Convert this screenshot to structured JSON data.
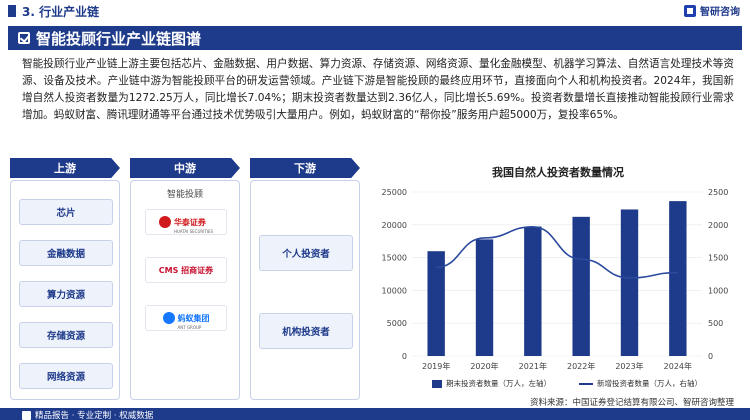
{
  "header": {
    "section_title": "3. 行业产业链",
    "brand_name": "智研咨询"
  },
  "banner": {
    "title": "智能投顾行业产业链图谱"
  },
  "intro": {
    "text": "智能投顾行业产业链上游主要包括芯片、金融数据、用户数据、算力资源、存储资源、网络资源、量化金融模型、机器学习算法、自然语言处理技术等资源、设备及技术。产业链中游为智能投顾平台的研发运营领域。产业链下游是智能投顾的最终应用环节，直接面向个人和机构投资者。2024年，我国新增自然人投资者数量为1272.25万人，同比增长7.04%；期末投资者数量达到2.36亿人，同比增长5.69%。投资者数量增长直接推动智能投顾行业需求增加。蚂蚁财富、腾讯理财通等平台通过技术优势吸引大量用户。例如，蚂蚁财富的“帮你投”服务用户超5000万，复投率65%。"
  },
  "chain": {
    "upstream": {
      "title": "上游",
      "items": [
        "芯片",
        "金融数据",
        "算力资源",
        "存储资源",
        "网络资源"
      ]
    },
    "midstream": {
      "title": "中游",
      "label": "智能投顾",
      "logos": [
        {
          "icon": "huatai-securities-logo",
          "text": "华泰证券",
          "sub": "HUATAI SECURITIES",
          "color": "#d0191c"
        },
        {
          "icon": "cms-securities-logo",
          "text": "CMS 招商证券",
          "sub": "",
          "color": "#c8102e"
        },
        {
          "icon": "ant-group-logo",
          "text": "蚂蚁集团",
          "sub": "ANT GROUP",
          "color": "#1677ff"
        }
      ]
    },
    "downstream": {
      "title": "下游",
      "items": [
        "个人投资者",
        "机构投资者"
      ]
    }
  },
  "chart_data": {
    "type": "bar",
    "title": "我国自然人投资者数量情况",
    "categories": [
      "2019年",
      "2020年",
      "2021年",
      "2022年",
      "2023年",
      "2024年"
    ],
    "series": [
      {
        "name": "期末投资者数量（万人，左轴）",
        "type": "bar",
        "axis": "left",
        "values": [
          15975,
          17777,
          19740,
          21214,
          22338,
          23610
        ]
      },
      {
        "name": "新增投资者数量（万人，右轴）",
        "type": "line",
        "axis": "right",
        "values": [
          1350,
          1800,
          1970,
          1475,
          1190,
          1272.25
        ]
      }
    ],
    "left_axis": {
      "min": 0,
      "max": 25000,
      "ticks": [
        "0",
        "5000",
        "10000",
        "15000",
        "20000",
        "25000"
      ]
    },
    "right_axis": {
      "min": 0,
      "max": 2500,
      "ticks": [
        "0",
        "500",
        "1000",
        "1500",
        "2000",
        "2500"
      ]
    },
    "colors": {
      "bar": "#1e3a8a",
      "line": "#2b4a9e"
    },
    "legend_position": "bottom"
  },
  "footer": {
    "source": "资料来源：中国证券登记结算有限公司、智研咨询整理",
    "slogan": "精品报告 · 专业定制 · 权威数据"
  },
  "colors": {
    "primary": "#1e3a8a",
    "panel_bg": "#eef3fb",
    "panel_border": "#c7d2e8"
  }
}
